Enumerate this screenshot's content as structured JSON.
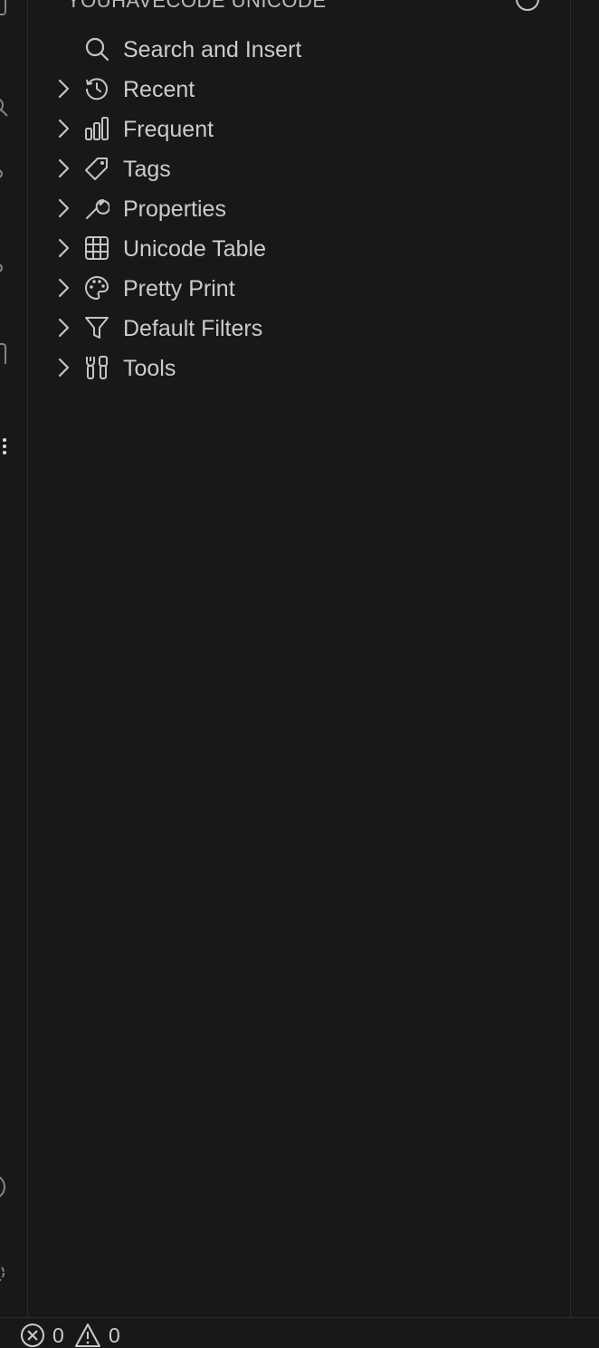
{
  "sidebar": {
    "section_title": "YOUHAVECODE UNICODE",
    "items": [
      {
        "label": "Search and Insert",
        "icon": "search-icon",
        "expandable": false
      },
      {
        "label": "Recent",
        "icon": "history-icon",
        "expandable": true
      },
      {
        "label": "Frequent",
        "icon": "bar-chart-icon",
        "expandable": true
      },
      {
        "label": "Tags",
        "icon": "tag-icon",
        "expandable": true
      },
      {
        "label": "Properties",
        "icon": "wrench-icon",
        "expandable": true
      },
      {
        "label": "Unicode Table",
        "icon": "table-icon",
        "expandable": true
      },
      {
        "label": "Pretty Print",
        "icon": "palette-icon",
        "expandable": true
      },
      {
        "label": "Default Filters",
        "icon": "filter-icon",
        "expandable": true
      },
      {
        "label": "Tools",
        "icon": "tools-icon",
        "expandable": true
      }
    ]
  },
  "status_bar": {
    "errors": "0",
    "warnings": "0"
  },
  "colors": {
    "background": "#181818",
    "text": "#cccccc",
    "icon": "#c5c5c5",
    "border": "#2b2b2b"
  }
}
